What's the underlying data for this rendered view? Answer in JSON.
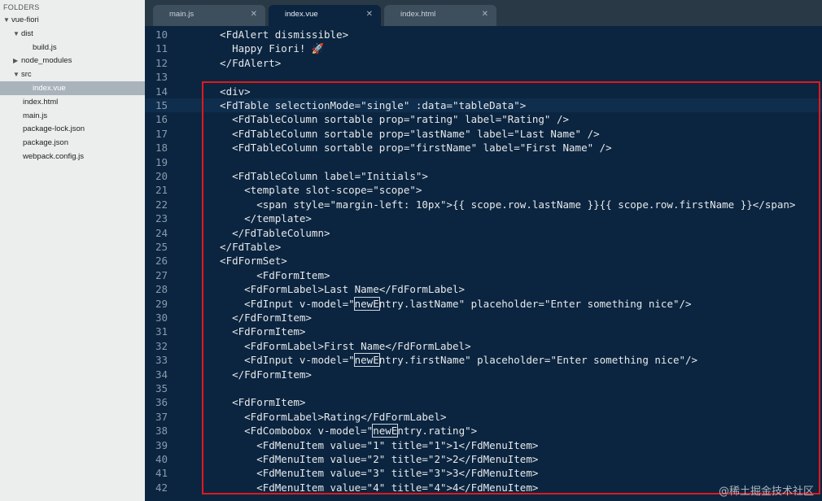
{
  "sidebar": {
    "header": "FOLDERS",
    "items": [
      {
        "label": "vue-fiori",
        "arrow": "▼"
      },
      {
        "label": "dist",
        "arrow": "▼"
      },
      {
        "label": "build.js",
        "arrow": ""
      },
      {
        "label": "node_modules",
        "arrow": "▶"
      },
      {
        "label": "src",
        "arrow": "▼"
      },
      {
        "label": "index.vue",
        "arrow": "",
        "selected": true
      },
      {
        "label": "index.html",
        "arrow": ""
      },
      {
        "label": "main.js",
        "arrow": ""
      },
      {
        "label": "package-lock.json",
        "arrow": ""
      },
      {
        "label": "package.json",
        "arrow": ""
      },
      {
        "label": "webpack.config.js",
        "arrow": ""
      }
    ]
  },
  "tabs": [
    {
      "label": "main.js",
      "active": false
    },
    {
      "label": "index.vue",
      "active": true
    },
    {
      "label": "index.html",
      "active": false
    }
  ],
  "tab_close_glyph": "✕",
  "editor": {
    "current_line": 15,
    "lines": [
      {
        "num": "10",
        "text": "  <FdAlert dismissible>"
      },
      {
        "num": "11",
        "text": "    Happy Fiori! 🚀"
      },
      {
        "num": "12",
        "text": "  </FdAlert>"
      },
      {
        "num": "13",
        "text": ""
      },
      {
        "num": "14",
        "text": "  <div>"
      },
      {
        "num": "15",
        "text": "  <FdTable selectionMode=\"single\" :data=\"tableData\">"
      },
      {
        "num": "16",
        "text": "    <FdTableColumn sortable prop=\"rating\" label=\"Rating\" />"
      },
      {
        "num": "17",
        "text": "    <FdTableColumn sortable prop=\"lastName\" label=\"Last Name\" />"
      },
      {
        "num": "18",
        "text": "    <FdTableColumn sortable prop=\"firstName\" label=\"First Name\" />"
      },
      {
        "num": "19",
        "text": ""
      },
      {
        "num": "20",
        "text": "    <FdTableColumn label=\"Initials\">"
      },
      {
        "num": "21",
        "text": "      <template slot-scope=\"scope\">"
      },
      {
        "num": "22",
        "text": "        <span style=\"margin-left: 10px\">{{ scope.row.lastName }}{{ scope.row.firstName }}</span>"
      },
      {
        "num": "23",
        "text": "      </template>"
      },
      {
        "num": "24",
        "text": "    </FdTableColumn>"
      },
      {
        "num": "25",
        "text": "  </FdTable>"
      },
      {
        "num": "26",
        "text": "  <FdFormSet>"
      },
      {
        "num": "27",
        "text": "        <FdFormItem>"
      },
      {
        "num": "28",
        "text": "      <FdFormLabel>Last Name</FdFormLabel>"
      },
      {
        "num": "29",
        "text": "      <FdInput v-model=\"newEntry.lastName\" placeholder=\"Enter something nice\"/>"
      },
      {
        "num": "30",
        "text": "    </FdFormItem>"
      },
      {
        "num": "31",
        "text": "    <FdFormItem>"
      },
      {
        "num": "32",
        "text": "      <FdFormLabel>First Name</FdFormLabel>"
      },
      {
        "num": "33",
        "text": "      <FdInput v-model=\"newEntry.firstName\" placeholder=\"Enter something nice\"/>"
      },
      {
        "num": "34",
        "text": "    </FdFormItem>"
      },
      {
        "num": "35",
        "text": ""
      },
      {
        "num": "36",
        "text": "    <FdFormItem>"
      },
      {
        "num": "37",
        "text": "      <FdFormLabel>Rating</FdFormLabel>"
      },
      {
        "num": "38",
        "text": "      <FdCombobox v-model=\"newEntry.rating\">"
      },
      {
        "num": "39",
        "text": "        <FdMenuItem value=\"1\" title=\"1\">1</FdMenuItem>"
      },
      {
        "num": "40",
        "text": "        <FdMenuItem value=\"2\" title=\"2\">2</FdMenuItem>"
      },
      {
        "num": "41",
        "text": "        <FdMenuItem value=\"3\" title=\"3\">3</FdMenuItem>"
      },
      {
        "num": "42",
        "text": "        <FdMenuItem value=\"4\" title=\"4\">4</FdMenuItem>"
      }
    ]
  },
  "watermark": "@稀土掘金技术社区",
  "colors": {
    "highlight_box": "#e0191c",
    "editor_bg": "#0b2540"
  }
}
